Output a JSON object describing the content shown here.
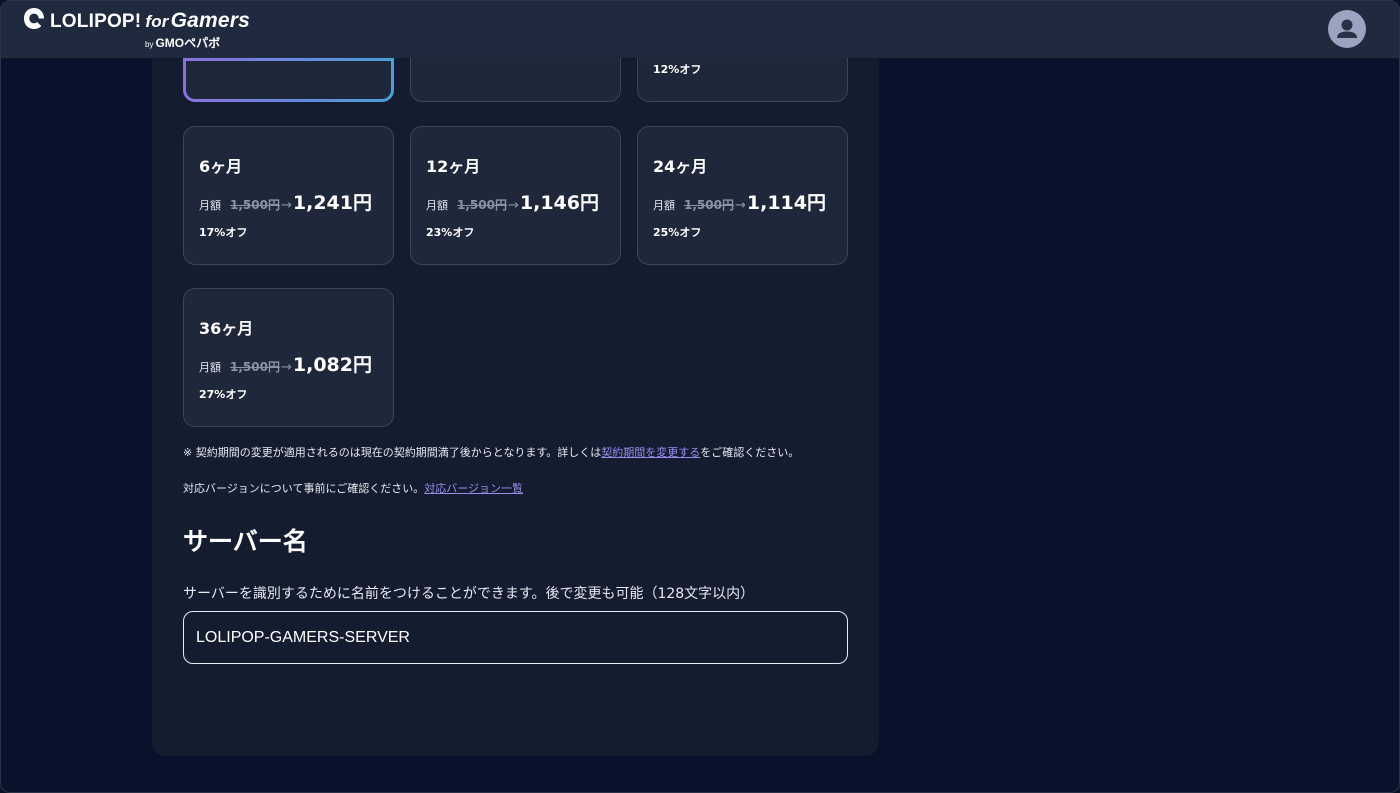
{
  "header": {
    "logo_main": "LOLIPOP!",
    "logo_for": "for",
    "logo_gamers": "Gamers",
    "logo_by": "by",
    "logo_company": "GMOペパボ"
  },
  "plans": {
    "partial_row": [
      {
        "discount": ""
      },
      {
        "discount": ""
      },
      {
        "discount": "12%オフ"
      }
    ],
    "cards": [
      {
        "title": "6ヶ月",
        "price_label": "月額",
        "old_price": "1,500円",
        "arrow": "→",
        "new_price": "1,241円",
        "discount": "17%オフ"
      },
      {
        "title": "12ヶ月",
        "price_label": "月額",
        "old_price": "1,500円",
        "arrow": "→",
        "new_price": "1,146円",
        "discount": "23%オフ"
      },
      {
        "title": "24ヶ月",
        "price_label": "月額",
        "old_price": "1,500円",
        "arrow": "→",
        "new_price": "1,114円",
        "discount": "25%オフ"
      },
      {
        "title": "36ヶ月",
        "price_label": "月額",
        "old_price": "1,500円",
        "arrow": "→",
        "new_price": "1,082円",
        "discount": "27%オフ"
      }
    ]
  },
  "notes": {
    "contract_pre": "※ 契約期間の変更が適用されるのは現在の契約期間満了後からとなります。詳しくは",
    "contract_link": "契約期間を変更する",
    "contract_post": "をご確認ください。",
    "version_pre": "対応バージョンについて事前にご確認ください。",
    "version_link": "対応バージョン一覧"
  },
  "server_name": {
    "title": "サーバー名",
    "description": "サーバーを識別するために名前をつけることができます。後で変更も可能（128文字以内）",
    "value": "LOLIPOP-GAMERS-SERVER"
  },
  "icons": {
    "logo": "lolipop-logo-icon",
    "avatar": "user-avatar-icon"
  }
}
